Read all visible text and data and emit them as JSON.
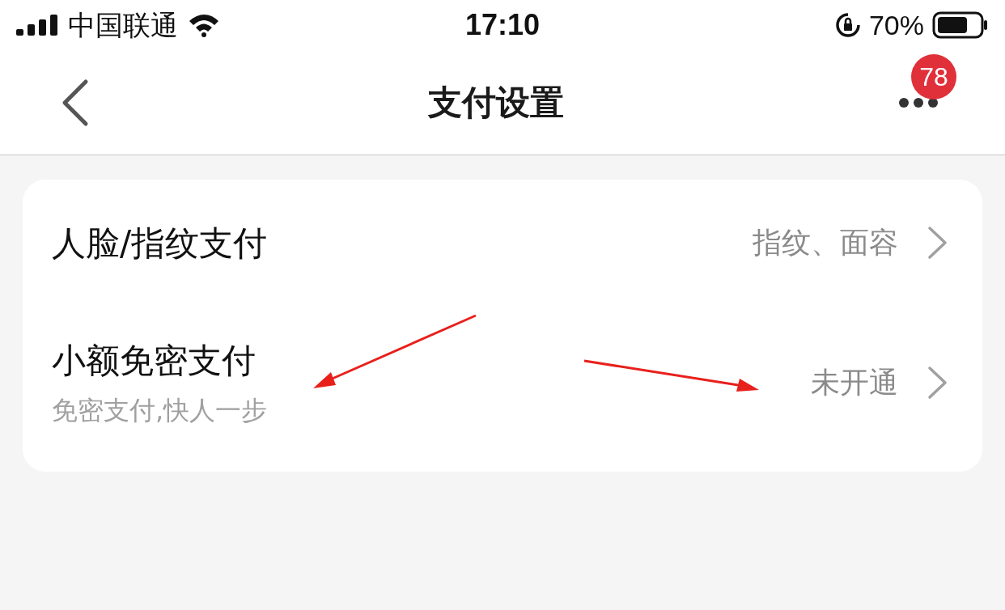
{
  "status_bar": {
    "carrier": "中国联通",
    "time": "17:10",
    "battery": "70%"
  },
  "nav": {
    "title": "支付设置",
    "badge": "78"
  },
  "rows": [
    {
      "title": "人脸/指纹支付",
      "value": "指纹、面容"
    },
    {
      "title": "小额免密支付",
      "subtitle": "免密支付,快人一步",
      "value": "未开通"
    }
  ]
}
